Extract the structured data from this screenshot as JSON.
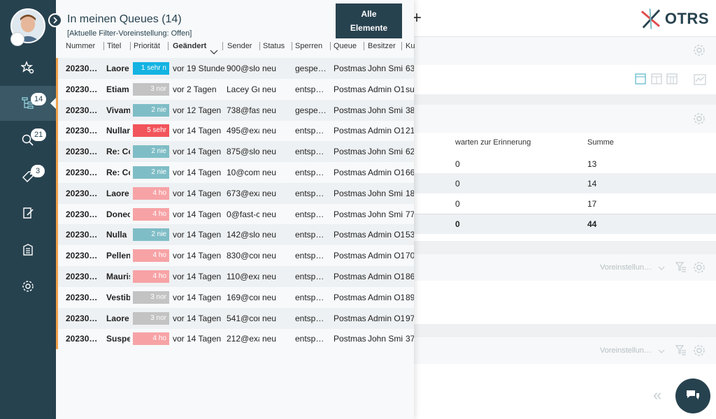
{
  "sidebar": {
    "items": [
      {
        "icon": "star-search-icon"
      },
      {
        "icon": "queue-tree-icon",
        "count": "14"
      },
      {
        "icon": "search-icon",
        "count": "21"
      },
      {
        "icon": "tag-icon",
        "count": "3"
      },
      {
        "icon": "edit-note-icon"
      },
      {
        "icon": "building-icon"
      },
      {
        "icon": "gear-icon"
      }
    ]
  },
  "overlay": {
    "title": "In meinen Queues (14)",
    "filter": "[Aktuelle Filter-Voreinstellung: Offen]",
    "all_button": "Alle Elemente",
    "columns": [
      "Nummer",
      "Titel",
      "Priorität",
      "Geändert",
      "Sender",
      "Status",
      "Sperren",
      "Queue",
      "Besitzer",
      "Ku"
    ],
    "rows": [
      {
        "num": "20230…",
        "title": "Laore",
        "prio": "1 sehr n",
        "prio_color": "#14b3e2",
        "changed": "vor 19 Stunde",
        "sender": "900@slo",
        "status": "neu",
        "lock": "gespe…",
        "queue": "Postmas",
        "owner": "John Smi",
        "ku": "63"
      },
      {
        "num": "20230…",
        "title": "Etiam",
        "prio": "3 nor",
        "prio_color": "#c3c3c3",
        "changed": "vor 2 Tagen",
        "sender": "Lacey Gr",
        "status": "neu",
        "lock": "entsp…",
        "queue": "Postmas",
        "owner": "Admin O1",
        "ku": "su"
      },
      {
        "num": "20230…",
        "title": "Vivam",
        "prio": "2 nie",
        "prio_color": "#7fbdc6",
        "changed": "vor 12 Tagen",
        "sender": "738@fas",
        "status": "neu",
        "lock": "gespe…",
        "queue": "Postmas",
        "owner": "John Smi",
        "ku": "38"
      },
      {
        "num": "20230…",
        "title": "Nullar",
        "prio": "5 sehr",
        "prio_color": "#f2545b",
        "changed": "vor 14 Tagen",
        "sender": "495@exa",
        "status": "neu",
        "lock": "entsp…",
        "queue": "Postmas",
        "owner": "Admin O1",
        "ku": "21"
      },
      {
        "num": "20230…",
        "title": "Re: Co",
        "prio": "2 nie",
        "prio_color": "#7fbdc6",
        "changed": "vor 14 Tagen",
        "sender": "875@slo",
        "status": "neu",
        "lock": "entsp…",
        "queue": "Postmas",
        "owner": "John Smi",
        "ku": "62"
      },
      {
        "num": "20230…",
        "title": "Re: Co",
        "prio": "2 nie",
        "prio_color": "#7fbdc6",
        "changed": "vor 14 Tagen",
        "sender": "10@com",
        "status": "neu",
        "lock": "entsp…",
        "queue": "Postmas",
        "owner": "Admin O1",
        "ku": "66"
      },
      {
        "num": "20230…",
        "title": "Laore",
        "prio": "4 ho",
        "prio_color": "#f7a3a6",
        "changed": "vor 14 Tagen",
        "sender": "673@exa",
        "status": "neu",
        "lock": "entsp…",
        "queue": "Postmas",
        "owner": "John Smi",
        "ku": "18"
      },
      {
        "num": "20230…",
        "title": "Donec",
        "prio": "4 ho",
        "prio_color": "#f7a3a6",
        "changed": "vor 14 Tagen",
        "sender": "0@fast-c",
        "status": "neu",
        "lock": "entsp…",
        "queue": "Postmas",
        "owner": "John Smi",
        "ku": "77"
      },
      {
        "num": "20230…",
        "title": "Nulla",
        "prio": "2 nie",
        "prio_color": "#7fbdc6",
        "changed": "vor 14 Tagen",
        "sender": "142@slo",
        "status": "neu",
        "lock": "entsp…",
        "queue": "Postmas",
        "owner": "Admin O1",
        "ku": "53"
      },
      {
        "num": "20230…",
        "title": "Pellen",
        "prio": "4 ho",
        "prio_color": "#f7a3a6",
        "changed": "vor 14 Tagen",
        "sender": "830@cor",
        "status": "neu",
        "lock": "entsp…",
        "queue": "Postmas",
        "owner": "Admin O1",
        "ku": "70"
      },
      {
        "num": "20230…",
        "title": "Mauris",
        "prio": "4 ho",
        "prio_color": "#f7a3a6",
        "changed": "vor 14 Tagen",
        "sender": "110@exa",
        "status": "neu",
        "lock": "entsp…",
        "queue": "Postmas",
        "owner": "Admin O1",
        "ku": "86"
      },
      {
        "num": "20230…",
        "title": "Vestib",
        "prio": "3 nor",
        "prio_color": "#c3c3c3",
        "changed": "vor 14 Tagen",
        "sender": "169@cor",
        "status": "neu",
        "lock": "entsp…",
        "queue": "Postmas",
        "owner": "Admin O1",
        "ku": "89"
      },
      {
        "num": "20230…",
        "title": "Laore",
        "prio": "3 nor",
        "prio_color": "#c3c3c3",
        "changed": "vor 14 Tagen",
        "sender": "541@cor",
        "status": "neu",
        "lock": "entsp…",
        "queue": "Postmas",
        "owner": "Admin O1",
        "ku": "97"
      },
      {
        "num": "20230…",
        "title": "Suspe",
        "prio": "4 ho",
        "prio_color": "#f7a3a6",
        "changed": "vor 14 Tagen",
        "sender": "212@exa",
        "status": "neu",
        "lock": "entsp…",
        "queue": "Postmas",
        "owner": "John Smi",
        "ku": "37"
      }
    ]
  },
  "dashboard": {
    "logo": "OTRS",
    "table_headers": [
      "warten zur Erinnerung",
      "Summe"
    ],
    "table_rows": [
      [
        "0",
        "13"
      ],
      [
        "0",
        "14"
      ],
      [
        "0",
        "17"
      ],
      [
        "0",
        "44"
      ]
    ],
    "preset_label_1": "Voreinstellun…",
    "preset_label_2": "Voreinstellun…"
  },
  "colors": {
    "sidebar": "#27424f",
    "accent_stripe": "#f0a14a"
  }
}
